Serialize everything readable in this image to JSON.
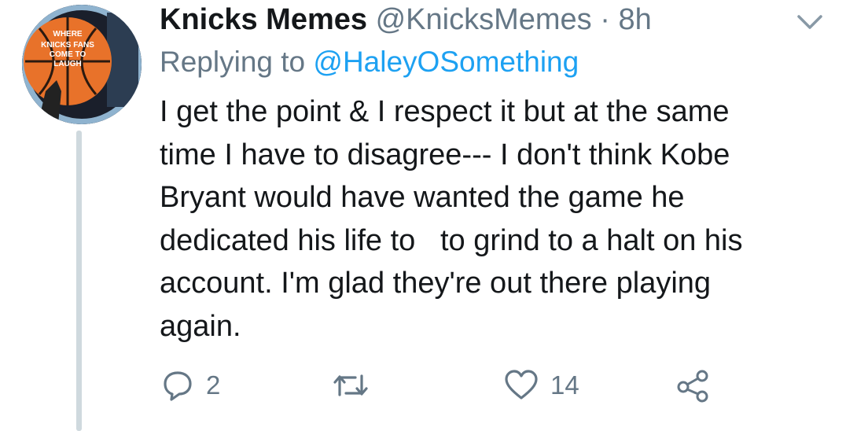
{
  "tweet": {
    "avatar": {
      "icon": "basketball-logo-icon",
      "text_lines": [
        "WHERE",
        "KNICKS FANS",
        "COME TO",
        "LAUGH"
      ],
      "colors": {
        "ball": "#e8722a",
        "ring": "#8fb3cf",
        "bg": "#1a1f2b"
      }
    },
    "display_name": "Knicks Memes",
    "handle": "@KnicksMemes",
    "separator": "·",
    "time": "8h",
    "reply_prefix": "Replying to",
    "reply_to": "@HaleyOSomething",
    "text": "I get the point & I respect it but at the same\ntime I have to disagree--- I don't think Kobe\nBryant would have wanted the game he\ndedicated his life to   to grind to a halt on his\naccount. I'm glad they're out there playing\nagain.",
    "actions": {
      "reply": {
        "icon": "reply-icon",
        "count": "2"
      },
      "retweet": {
        "icon": "retweet-icon",
        "count": ""
      },
      "like": {
        "icon": "heart-icon",
        "count": "14"
      },
      "share": {
        "icon": "share-icon"
      }
    },
    "colors": {
      "text": "#14171a",
      "muted": "#657786",
      "link": "#1da1f2",
      "thread": "#cfd9de"
    }
  }
}
